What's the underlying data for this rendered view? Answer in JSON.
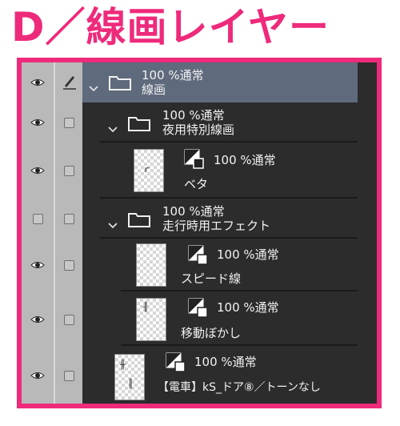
{
  "heading": "D／線画レイヤー",
  "layers": [
    {
      "kind": "folder",
      "blend": "100 %通常",
      "name": "線画"
    },
    {
      "kind": "folder",
      "blend": "100 %通常",
      "name": "夜用特別線画"
    },
    {
      "kind": "layer",
      "blend": "100 %通常",
      "name": "ベタ"
    },
    {
      "kind": "folder",
      "blend": "100 %通常",
      "name": "走行時用エフェクト"
    },
    {
      "kind": "layer",
      "blend": "100 %通常",
      "name": "スピード線"
    },
    {
      "kind": "layer",
      "blend": "100 %通常",
      "name": "移動ぼかし"
    },
    {
      "kind": "layer",
      "blend": "100 %通常",
      "name": "【電車】kS_ドア⑧／トーンなし"
    }
  ],
  "colors": {
    "accent": "#ee2a7b",
    "panel": "#2c2c2c",
    "selected": "#5f6a7d"
  }
}
